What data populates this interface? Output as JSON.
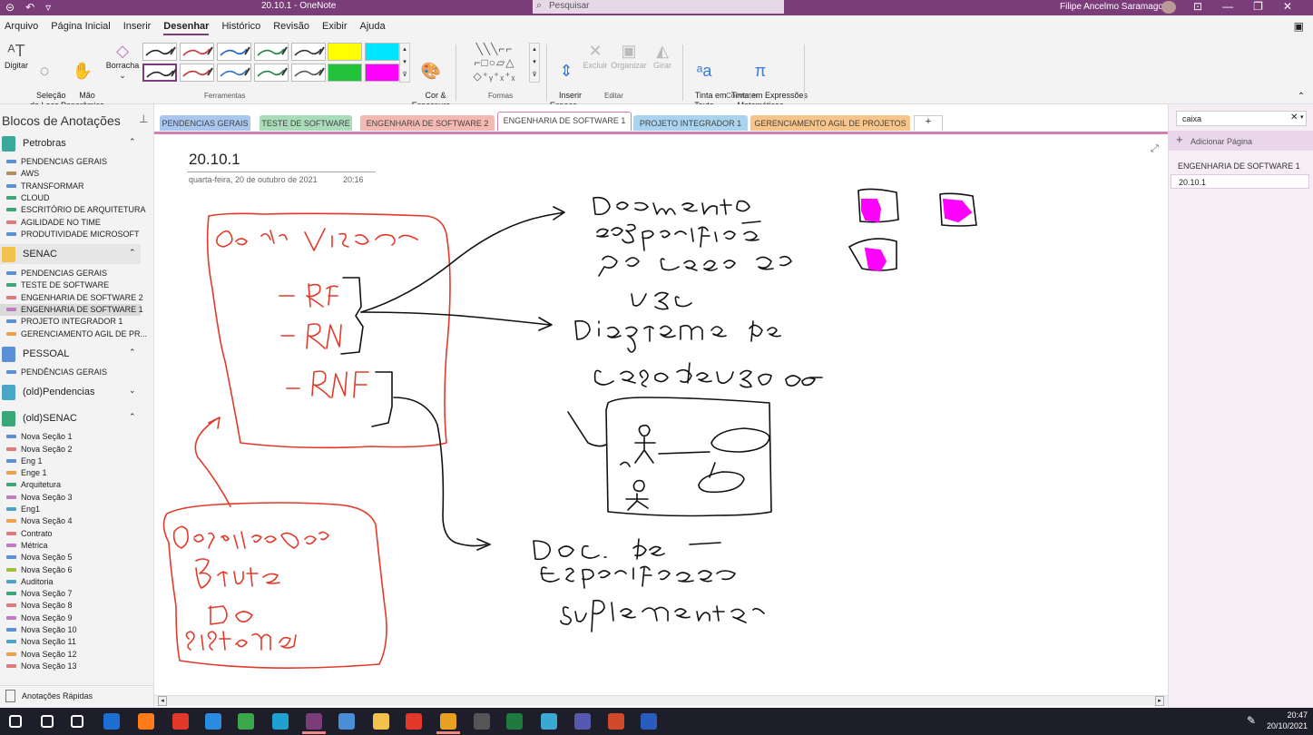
{
  "titlebar": {
    "title": "20.10.1 - OneNote",
    "search_placeholder": "Pesquisar",
    "user": "Filipe Ancelmo Saramago"
  },
  "menu": {
    "tabs": [
      "Arquivo",
      "Página Inicial",
      "Inserir",
      "Desenhar",
      "Histórico",
      "Revisão",
      "Exibir",
      "Ajuda"
    ],
    "active": "Desenhar"
  },
  "ribbon": {
    "digitar": "Digitar",
    "selecao": "Seleção\nde Laço",
    "mao": "Mão\nPanorâmica",
    "borracha": "Borracha",
    "cor_espessura": "Cor &\nEspessura",
    "group_ferramentas": "Ferramentas",
    "group_formas": "Formas",
    "inserir_espaco": "Inserir\nEspaço",
    "excluir": "Excluir",
    "organizar": "Organizar",
    "girar": "Girar",
    "group_editar": "Editar",
    "tinta_texto": "Tinta em\nTexto",
    "tinta_expr": "Tinta em Expressões\nMatemáticas",
    "group_converter": "Converter",
    "pen_colors": [
      "#222222",
      "#d03030",
      "#2060c0",
      "#208040",
      "#333333",
      "#222222",
      "#c03030",
      "#3070c0",
      "#208040",
      "#555555"
    ],
    "highlighter_colors": [
      "#ffff00",
      "#00e5ff",
      "#22c33a",
      "#ff00ff"
    ]
  },
  "sidebar": {
    "header": "Blocos de Anotações",
    "notebooks": [
      {
        "name": "Petrobras",
        "color": "#3aa89a",
        "chev": "^",
        "sections": [
          {
            "name": "PENDENCIAS GERAIS",
            "color": "#5b8fd6"
          },
          {
            "name": "AWS",
            "color": "#b28f5a"
          },
          {
            "name": "TRANSFORMAR",
            "color": "#5b8fd6"
          },
          {
            "name": "CLOUD",
            "color": "#3aa876"
          },
          {
            "name": "ESCRITÓRIO DE ARQUITETURA",
            "color": "#3aa876"
          },
          {
            "name": "AGILIDADE NO TIME",
            "color": "#e07b7b"
          },
          {
            "name": "PRODUTIVIDADE MICROSOFT",
            "color": "#5b8fd6"
          }
        ]
      },
      {
        "name": "SENAC",
        "color": "#f2c14e",
        "chev": "^",
        "sections": [
          {
            "name": "PENDENCIAS GERAIS",
            "color": "#5b8fd6"
          },
          {
            "name": "TESTE DE SOFTWARE",
            "color": "#3aa876"
          },
          {
            "name": "ENGENHARIA DE SOFTWARE 2",
            "color": "#e07b7b"
          },
          {
            "name": "ENGENHARIA DE SOFTWARE 1",
            "color": "#c27bc2",
            "selected": true
          },
          {
            "name": "PROJETO INTEGRADOR 1",
            "color": "#5b8fd6"
          },
          {
            "name": "GERENCIAMENTO AGIL DE PR...",
            "color": "#f0a046"
          }
        ]
      },
      {
        "name": "PESSOAL",
        "color": "#5b8fd6",
        "chev": "^",
        "sections": [
          {
            "name": "PENDÊNCIAS GERAIS",
            "color": "#5b8fd6"
          }
        ]
      },
      {
        "name": "(old)Pendencias",
        "color": "#4aa6c8",
        "chev": "v",
        "sections": []
      },
      {
        "name": "(old)SENAC",
        "color": "#3aa876",
        "chev": "^",
        "sections": [
          {
            "name": "Nova Seção 1",
            "color": "#5b8fd6"
          },
          {
            "name": "Nova Seção 2",
            "color": "#e07b7b"
          },
          {
            "name": "Eng 1",
            "color": "#5b8fd6"
          },
          {
            "name": "Enge 1",
            "color": "#f0a046"
          },
          {
            "name": "Arquitetura",
            "color": "#3aa876"
          },
          {
            "name": "Nova Seção 3",
            "color": "#c27bc2"
          },
          {
            "name": "Eng1",
            "color": "#4aa6c8"
          },
          {
            "name": "Nova Seção 4",
            "color": "#f0a046"
          },
          {
            "name": "Contrato",
            "color": "#e07b7b"
          },
          {
            "name": "Métrica",
            "color": "#c27bc2"
          },
          {
            "name": "Nova Seção 5",
            "color": "#5b8fd6"
          },
          {
            "name": "Nova Seção 6",
            "color": "#9bc13a"
          },
          {
            "name": "Auditoria",
            "color": "#4aa6c8"
          },
          {
            "name": "Nova Seção 7",
            "color": "#3aa876"
          },
          {
            "name": "Nova Seção 8",
            "color": "#e07b7b"
          },
          {
            "name": "Nova Seção 9",
            "color": "#c27bc2"
          },
          {
            "name": "Nova Seção 10",
            "color": "#5b8fd6"
          },
          {
            "name": "Nova Seção 11",
            "color": "#4aa6c8"
          },
          {
            "name": "Nova Seção 12",
            "color": "#f0a046"
          },
          {
            "name": "Nova Seção 13",
            "color": "#e07b7b"
          }
        ]
      }
    ],
    "quick_notes": "Anotações Rápidas"
  },
  "section_tabs": [
    {
      "name": "PENDENCIAS GERAIS",
      "color": "#a9c6ee"
    },
    {
      "name": "TESTE DE SOFTWARE",
      "color": "#a9dcb8"
    },
    {
      "name": "ENGENHARIA DE SOFTWARE 2",
      "color": "#f4b9b0"
    },
    {
      "name": "ENGENHARIA DE SOFTWARE 1",
      "color": "#e3b5e3",
      "active": true
    },
    {
      "name": "PROJETO INTEGRADOR 1",
      "color": "#a9d3ee"
    },
    {
      "name": "GERENCIAMENTO AGIL DE PROJETOS",
      "color": "#f7c58a"
    }
  ],
  "page": {
    "title": "20.10.1",
    "date": "quarta-feira, 20 de outubro de 2021",
    "time": "20:16"
  },
  "right_pane": {
    "search_value": "caixa",
    "add_page": "Adicionar Página",
    "section_name": "ENGENHARIA DE SOFTWARE 1",
    "pages": [
      "20.10.1"
    ]
  },
  "taskbar": {
    "time": "20:47",
    "date": "20/10/2021"
  }
}
